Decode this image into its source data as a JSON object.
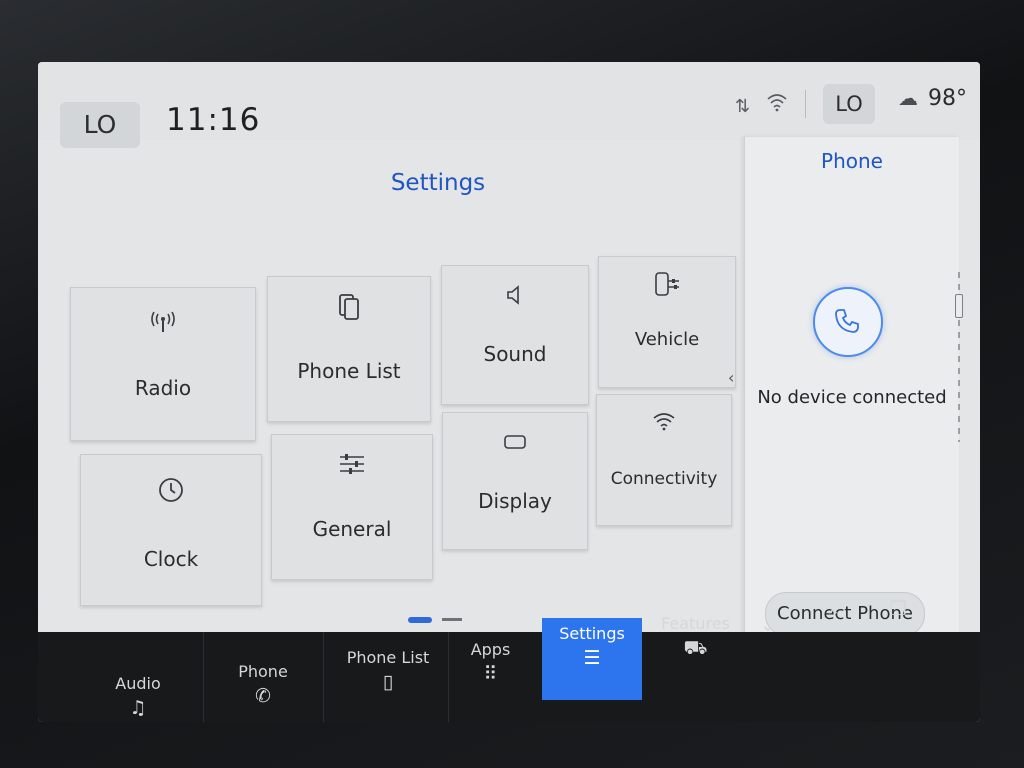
{
  "status": {
    "climate_left": "LO",
    "time": "11:16",
    "climate_right": "LO",
    "temperature": "98°",
    "icons": [
      "data-transfer-icon",
      "wifi-icon",
      "weather-icon"
    ]
  },
  "main": {
    "title": "Settings",
    "tiles": [
      {
        "label": "Radio",
        "icon": "radio-antenna-icon"
      },
      {
        "label": "Phone List",
        "icon": "phone-list-icon"
      },
      {
        "label": "Sound",
        "icon": "speaker-icon"
      },
      {
        "label": "Vehicle",
        "icon": "vehicle-settings-icon"
      },
      {
        "label": "Clock",
        "icon": "clock-icon"
      },
      {
        "label": "General",
        "icon": "sliders-icon"
      },
      {
        "label": "Display",
        "icon": "display-icon"
      },
      {
        "label": "Connectivity",
        "icon": "wifi-icon"
      }
    ],
    "page_indicator": {
      "current": 1,
      "total": 2
    }
  },
  "phone_panel": {
    "title": "Phone",
    "message": "No device connected",
    "button": "Connect Phone"
  },
  "nav": {
    "items": [
      {
        "label": "Audio",
        "icon": "music-note-icon"
      },
      {
        "label": "Phone",
        "icon": "phone-icon"
      },
      {
        "label": "Phone List",
        "icon": "phone-list-icon"
      },
      {
        "label": "Apps",
        "icon": "apps-grid-icon"
      },
      {
        "label": "Settings",
        "icon": "sliders-icon",
        "active": true
      },
      {
        "label": "Features",
        "icon": "truck-icon"
      }
    ],
    "controls": [
      "chevron-down-icon",
      "chevron-up-icon",
      "copy-icon"
    ]
  },
  "colors": {
    "accent": "#1f56c4",
    "active_tab": "#2d74ef"
  }
}
